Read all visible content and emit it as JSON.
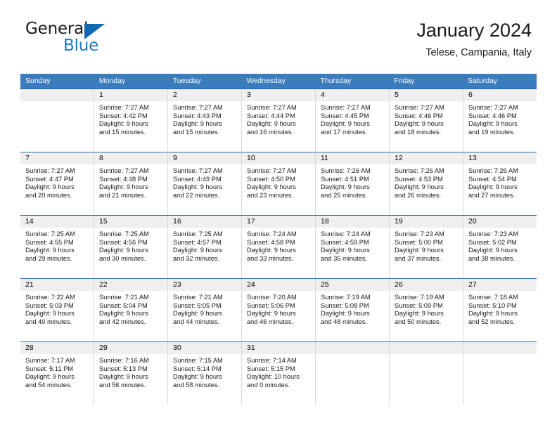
{
  "brand": {
    "name_part1": "General",
    "name_part2": "Blue",
    "triangle_icon": "triangle-icon",
    "accent_color": "#1268b3"
  },
  "header": {
    "title": "January 2024",
    "subtitle": "Telese, Campania, Italy"
  },
  "theme": {
    "header_row_bg": "#3a7cbe",
    "daynum_band_bg": "#efefef",
    "week_divider": "#2b6ca8",
    "cell_divider": "#d9d9d9"
  },
  "weekdays": [
    "Sunday",
    "Monday",
    "Tuesday",
    "Wednesday",
    "Thursday",
    "Friday",
    "Saturday"
  ],
  "labels": {
    "sunrise_prefix": "Sunrise:",
    "sunset_prefix": "Sunset:",
    "daylight_prefix": "Daylight:"
  },
  "weeks": [
    [
      {
        "day": "",
        "sunrise": "",
        "sunset": "",
        "daylight_line1": "",
        "daylight_line2": ""
      },
      {
        "day": "1",
        "sunrise": "Sunrise: 7:27 AM",
        "sunset": "Sunset: 4:42 PM",
        "daylight_line1": "Daylight: 9 hours",
        "daylight_line2": "and 15 minutes."
      },
      {
        "day": "2",
        "sunrise": "Sunrise: 7:27 AM",
        "sunset": "Sunset: 4:43 PM",
        "daylight_line1": "Daylight: 9 hours",
        "daylight_line2": "and 15 minutes."
      },
      {
        "day": "3",
        "sunrise": "Sunrise: 7:27 AM",
        "sunset": "Sunset: 4:44 PM",
        "daylight_line1": "Daylight: 9 hours",
        "daylight_line2": "and 16 minutes."
      },
      {
        "day": "4",
        "sunrise": "Sunrise: 7:27 AM",
        "sunset": "Sunset: 4:45 PM",
        "daylight_line1": "Daylight: 9 hours",
        "daylight_line2": "and 17 minutes."
      },
      {
        "day": "5",
        "sunrise": "Sunrise: 7:27 AM",
        "sunset": "Sunset: 4:46 PM",
        "daylight_line1": "Daylight: 9 hours",
        "daylight_line2": "and 18 minutes."
      },
      {
        "day": "6",
        "sunrise": "Sunrise: 7:27 AM",
        "sunset": "Sunset: 4:46 PM",
        "daylight_line1": "Daylight: 9 hours",
        "daylight_line2": "and 19 minutes."
      }
    ],
    [
      {
        "day": "7",
        "sunrise": "Sunrise: 7:27 AM",
        "sunset": "Sunset: 4:47 PM",
        "daylight_line1": "Daylight: 9 hours",
        "daylight_line2": "and 20 minutes."
      },
      {
        "day": "8",
        "sunrise": "Sunrise: 7:27 AM",
        "sunset": "Sunset: 4:48 PM",
        "daylight_line1": "Daylight: 9 hours",
        "daylight_line2": "and 21 minutes."
      },
      {
        "day": "9",
        "sunrise": "Sunrise: 7:27 AM",
        "sunset": "Sunset: 4:49 PM",
        "daylight_line1": "Daylight: 9 hours",
        "daylight_line2": "and 22 minutes."
      },
      {
        "day": "10",
        "sunrise": "Sunrise: 7:27 AM",
        "sunset": "Sunset: 4:50 PM",
        "daylight_line1": "Daylight: 9 hours",
        "daylight_line2": "and 23 minutes."
      },
      {
        "day": "11",
        "sunrise": "Sunrise: 7:26 AM",
        "sunset": "Sunset: 4:51 PM",
        "daylight_line1": "Daylight: 9 hours",
        "daylight_line2": "and 25 minutes."
      },
      {
        "day": "12",
        "sunrise": "Sunrise: 7:26 AM",
        "sunset": "Sunset: 4:53 PM",
        "daylight_line1": "Daylight: 9 hours",
        "daylight_line2": "and 26 minutes."
      },
      {
        "day": "13",
        "sunrise": "Sunrise: 7:26 AM",
        "sunset": "Sunset: 4:54 PM",
        "daylight_line1": "Daylight: 9 hours",
        "daylight_line2": "and 27 minutes."
      }
    ],
    [
      {
        "day": "14",
        "sunrise": "Sunrise: 7:25 AM",
        "sunset": "Sunset: 4:55 PM",
        "daylight_line1": "Daylight: 9 hours",
        "daylight_line2": "and 29 minutes."
      },
      {
        "day": "15",
        "sunrise": "Sunrise: 7:25 AM",
        "sunset": "Sunset: 4:56 PM",
        "daylight_line1": "Daylight: 9 hours",
        "daylight_line2": "and 30 minutes."
      },
      {
        "day": "16",
        "sunrise": "Sunrise: 7:25 AM",
        "sunset": "Sunset: 4:57 PM",
        "daylight_line1": "Daylight: 9 hours",
        "daylight_line2": "and 32 minutes."
      },
      {
        "day": "17",
        "sunrise": "Sunrise: 7:24 AM",
        "sunset": "Sunset: 4:58 PM",
        "daylight_line1": "Daylight: 9 hours",
        "daylight_line2": "and 33 minutes."
      },
      {
        "day": "18",
        "sunrise": "Sunrise: 7:24 AM",
        "sunset": "Sunset: 4:59 PM",
        "daylight_line1": "Daylight: 9 hours",
        "daylight_line2": "and 35 minutes."
      },
      {
        "day": "19",
        "sunrise": "Sunrise: 7:23 AM",
        "sunset": "Sunset: 5:00 PM",
        "daylight_line1": "Daylight: 9 hours",
        "daylight_line2": "and 37 minutes."
      },
      {
        "day": "20",
        "sunrise": "Sunrise: 7:23 AM",
        "sunset": "Sunset: 5:02 PM",
        "daylight_line1": "Daylight: 9 hours",
        "daylight_line2": "and 38 minutes."
      }
    ],
    [
      {
        "day": "21",
        "sunrise": "Sunrise: 7:22 AM",
        "sunset": "Sunset: 5:03 PM",
        "daylight_line1": "Daylight: 9 hours",
        "daylight_line2": "and 40 minutes."
      },
      {
        "day": "22",
        "sunrise": "Sunrise: 7:21 AM",
        "sunset": "Sunset: 5:04 PM",
        "daylight_line1": "Daylight: 9 hours",
        "daylight_line2": "and 42 minutes."
      },
      {
        "day": "23",
        "sunrise": "Sunrise: 7:21 AM",
        "sunset": "Sunset: 5:05 PM",
        "daylight_line1": "Daylight: 9 hours",
        "daylight_line2": "and 44 minutes."
      },
      {
        "day": "24",
        "sunrise": "Sunrise: 7:20 AM",
        "sunset": "Sunset: 5:06 PM",
        "daylight_line1": "Daylight: 9 hours",
        "daylight_line2": "and 46 minutes."
      },
      {
        "day": "25",
        "sunrise": "Sunrise: 7:19 AM",
        "sunset": "Sunset: 5:08 PM",
        "daylight_line1": "Daylight: 9 hours",
        "daylight_line2": "and 48 minutes."
      },
      {
        "day": "26",
        "sunrise": "Sunrise: 7:19 AM",
        "sunset": "Sunset: 5:09 PM",
        "daylight_line1": "Daylight: 9 hours",
        "daylight_line2": "and 50 minutes."
      },
      {
        "day": "27",
        "sunrise": "Sunrise: 7:18 AM",
        "sunset": "Sunset: 5:10 PM",
        "daylight_line1": "Daylight: 9 hours",
        "daylight_line2": "and 52 minutes."
      }
    ],
    [
      {
        "day": "28",
        "sunrise": "Sunrise: 7:17 AM",
        "sunset": "Sunset: 5:11 PM",
        "daylight_line1": "Daylight: 9 hours",
        "daylight_line2": "and 54 minutes."
      },
      {
        "day": "29",
        "sunrise": "Sunrise: 7:16 AM",
        "sunset": "Sunset: 5:13 PM",
        "daylight_line1": "Daylight: 9 hours",
        "daylight_line2": "and 56 minutes."
      },
      {
        "day": "30",
        "sunrise": "Sunrise: 7:15 AM",
        "sunset": "Sunset: 5:14 PM",
        "daylight_line1": "Daylight: 9 hours",
        "daylight_line2": "and 58 minutes."
      },
      {
        "day": "31",
        "sunrise": "Sunrise: 7:14 AM",
        "sunset": "Sunset: 5:15 PM",
        "daylight_line1": "Daylight: 10 hours",
        "daylight_line2": "and 0 minutes."
      },
      {
        "day": "",
        "sunrise": "",
        "sunset": "",
        "daylight_line1": "",
        "daylight_line2": ""
      },
      {
        "day": "",
        "sunrise": "",
        "sunset": "",
        "daylight_line1": "",
        "daylight_line2": ""
      },
      {
        "day": "",
        "sunrise": "",
        "sunset": "",
        "daylight_line1": "",
        "daylight_line2": ""
      }
    ]
  ]
}
